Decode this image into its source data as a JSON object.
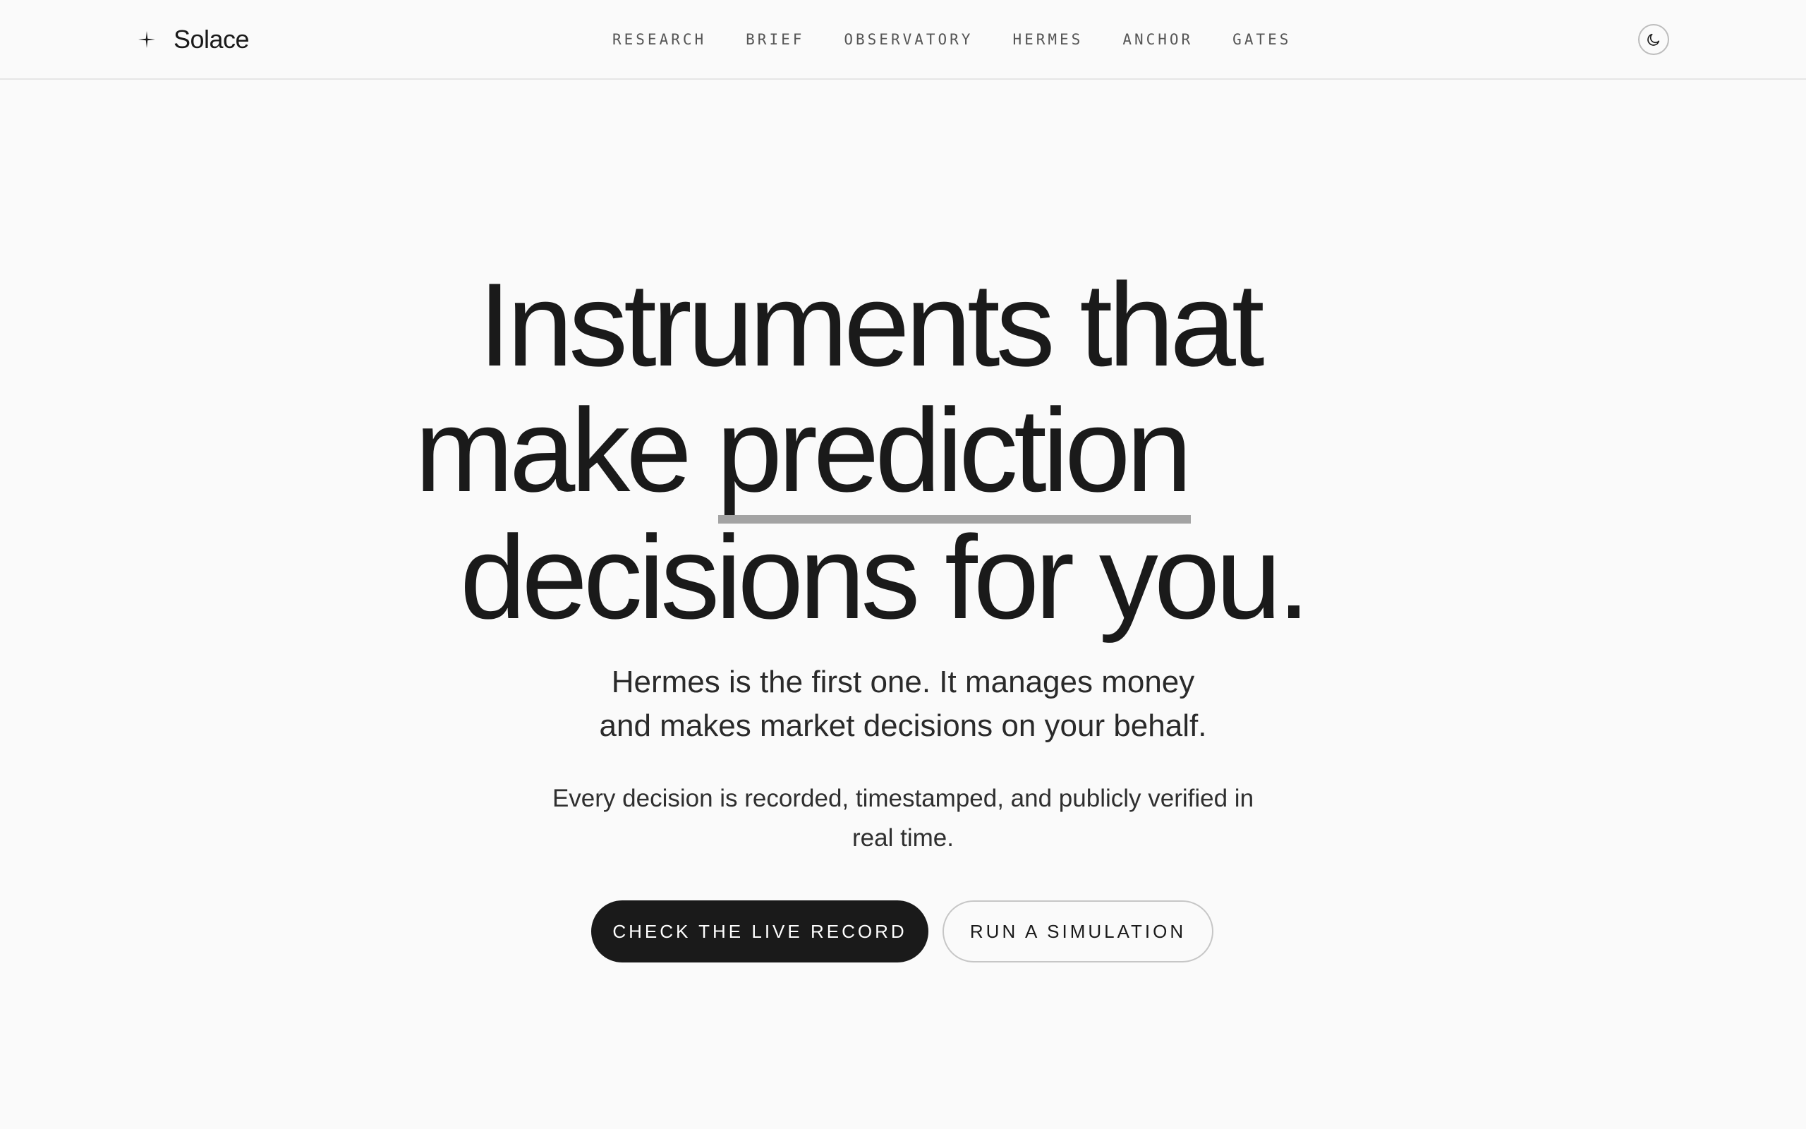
{
  "brand": {
    "name": "Solace",
    "icon": "sparkle-star-icon"
  },
  "nav": {
    "items": [
      {
        "label": "RESEARCH"
      },
      {
        "label": "BRIEF"
      },
      {
        "label": "OBSERVATORY"
      },
      {
        "label": "HERMES"
      },
      {
        "label": "ANCHOR"
      },
      {
        "label": "GATES"
      }
    ]
  },
  "theme_toggle": {
    "icon": "moon-icon"
  },
  "hero": {
    "headline_line1": "Instruments that",
    "headline_line2_prefix": "make ",
    "headline_highlight": "prediction",
    "headline_line3": "decisions for you.",
    "subtitle_line1": "Hermes is the first one. It manages money",
    "subtitle_line2": "and makes market decisions on your behalf.",
    "note_line1": "Every decision is recorded, timestamped, and publicly verified in",
    "note_line2": "real time.",
    "primary_cta": "CHECK THE LIVE RECORD",
    "secondary_cta": "RUN A SIMULATION"
  },
  "colors": {
    "background": "#fafafa",
    "text": "#1a1a1a",
    "underline": "#a3a3a3",
    "button_primary": "#1a1a1a",
    "button_secondary_border": "#c6c6c6"
  }
}
